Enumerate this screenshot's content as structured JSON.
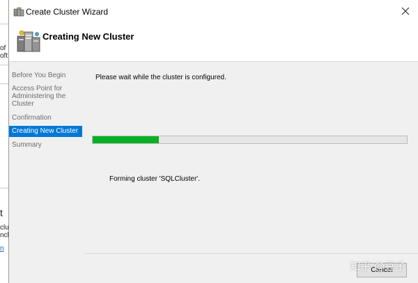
{
  "background_window": {
    "snippets": [
      "of",
      "oft",
      "t",
      "clus",
      "ncl",
      "n"
    ]
  },
  "dialog": {
    "title": "Create Cluster Wizard",
    "close_glyph": "✕",
    "header_title": "Creating New Cluster",
    "steps": [
      {
        "label": "Before You Begin",
        "active": false
      },
      {
        "label": "Access Point for Administering the Cluster",
        "active": false
      },
      {
        "label": "Confirmation",
        "active": false
      },
      {
        "label": "Creating New Cluster",
        "active": true
      },
      {
        "label": "Summary",
        "active": false
      }
    ],
    "wait_message": "Please wait while the cluster is configured.",
    "progress_percent": 21,
    "status_message": "Forming cluster 'SQLCluster'.",
    "cancel_label": "Cancel"
  },
  "watermark": "知乎 @豆子",
  "colors": {
    "accent": "#0078d7",
    "progress": "#06b025",
    "panel": "#f0f0f0"
  },
  "icons": {
    "title": "cluster-icon",
    "header": "server-cluster-icon",
    "close": "close-icon"
  }
}
